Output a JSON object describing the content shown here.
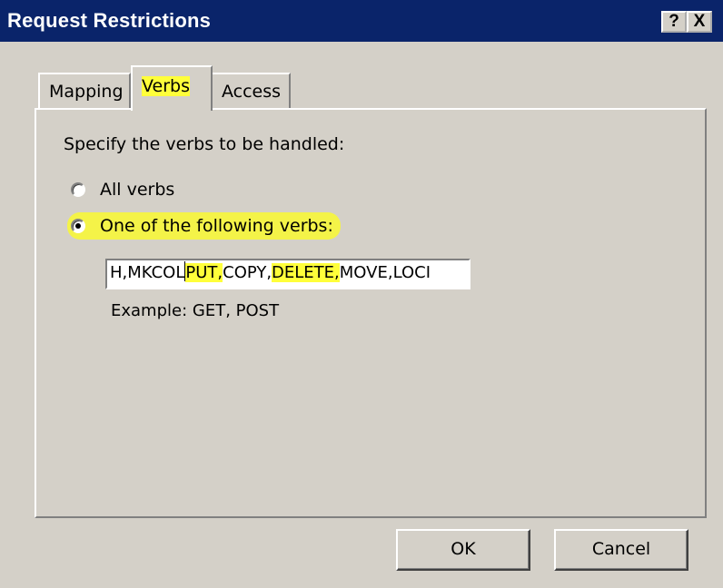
{
  "window": {
    "title": "Request Restrictions",
    "help_glyph": "?",
    "close_glyph": "X"
  },
  "tabs": [
    {
      "label": "Mapping",
      "selected": false
    },
    {
      "label": "Verbs",
      "selected": true
    },
    {
      "label": "Access",
      "selected": false
    }
  ],
  "verbs_tab": {
    "instruction": "Specify the verbs to be handled:",
    "option_all": {
      "label": "All verbs",
      "checked": false
    },
    "option_one": {
      "label": "One of the following verbs:",
      "checked": true
    },
    "verbs_input": {
      "text_before": "H,MKCOL",
      "highlight_put": "PUT,",
      "text_mid": "COPY,",
      "highlight_delete": "DELETE,",
      "text_after": "MOVE,LOCI"
    },
    "example": "Example: GET, POST"
  },
  "buttons": {
    "ok": "OK",
    "cancel": "Cancel"
  },
  "colors": {
    "title_bar": "#0a246a",
    "dialog_bg": "#d4d0c8",
    "highlight": "#ffff3a"
  }
}
